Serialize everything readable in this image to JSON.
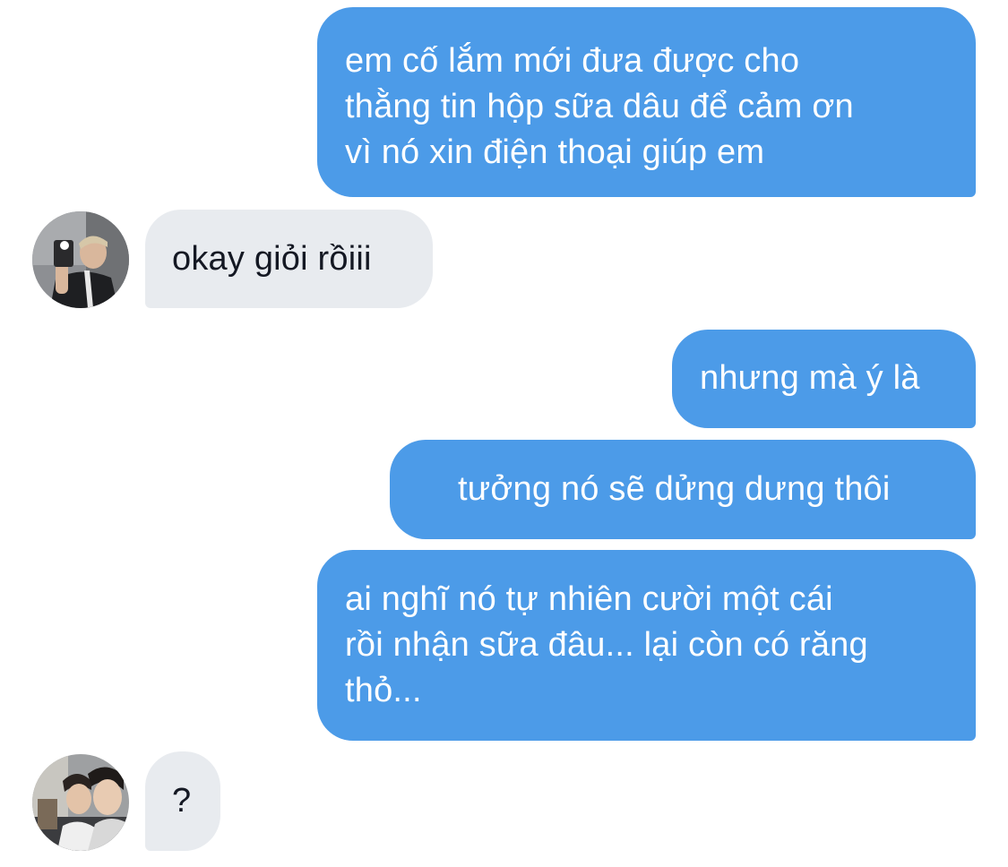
{
  "conversation": {
    "messages": [
      {
        "direction": "outgoing",
        "text": "em cố lắm mới đưa được cho\nthằng tin hộp sữa dâu để cảm ơn\nvì nó xin điện thoại giúp em"
      },
      {
        "direction": "incoming",
        "avatar": "selfie-avatar-icon",
        "text": "okay giỏi rồiii"
      },
      {
        "direction": "outgoing",
        "text": "nhưng mà ý là"
      },
      {
        "direction": "outgoing",
        "text": "tưởng nó sẽ dửng dưng thôi"
      },
      {
        "direction": "outgoing",
        "text": "ai nghĩ nó tự nhiên cười một cái\nrồi nhận sữa đâu... lại còn có răng\nthỏ..."
      },
      {
        "direction": "incoming",
        "avatar": "two-people-avatar-icon",
        "text": "?"
      }
    ]
  },
  "colors": {
    "outgoing_bubble": "#4c9be8",
    "incoming_bubble": "#e8ebef",
    "outgoing_text": "#ffffff",
    "incoming_text": "#141823"
  }
}
